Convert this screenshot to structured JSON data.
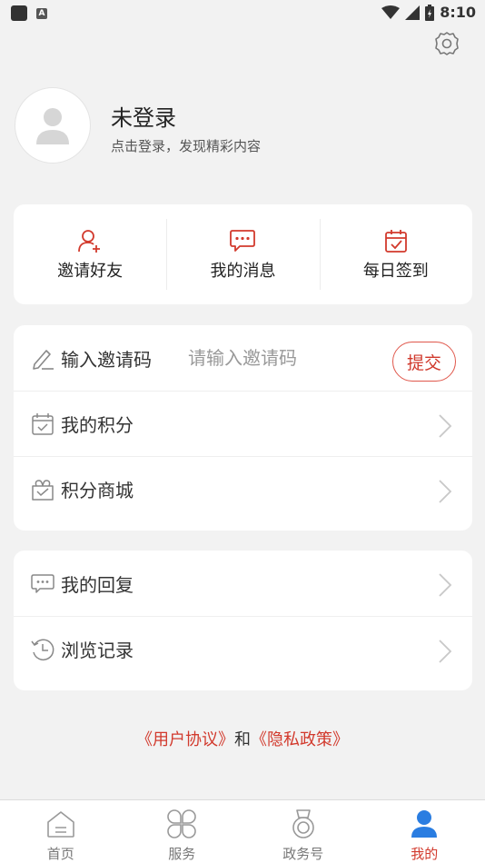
{
  "status_bar": {
    "time": "8:10",
    "notif_icon": "A"
  },
  "profile": {
    "title": "未登录",
    "subtitle": "点击登录，发现精彩内容"
  },
  "quick_actions": [
    {
      "label": "邀请好友",
      "icon": "user-add-icon"
    },
    {
      "label": "我的消息",
      "icon": "message-icon"
    },
    {
      "label": "每日签到",
      "icon": "calendar-check-icon"
    }
  ],
  "invite": {
    "label": "输入邀请码",
    "placeholder": "请输入邀请码",
    "submit_label": "提交"
  },
  "menu": {
    "points_label": "我的积分",
    "mall_label": "积分商城",
    "replies_label": "我的回复",
    "history_label": "浏览记录"
  },
  "agreement": {
    "user_agreement": "《用户协议》",
    "and": "和",
    "privacy_policy": "《隐私政策》"
  },
  "bottom_nav": [
    {
      "label": "首页",
      "icon": "home-icon"
    },
    {
      "label": "服务",
      "icon": "services-icon"
    },
    {
      "label": "政务号",
      "icon": "medal-icon"
    },
    {
      "label": "我的",
      "icon": "profile-icon",
      "active": true
    }
  ],
  "colors": {
    "accent": "#d23a2d",
    "active_blue": "#2a7de1",
    "background": "#f2f2f2"
  }
}
